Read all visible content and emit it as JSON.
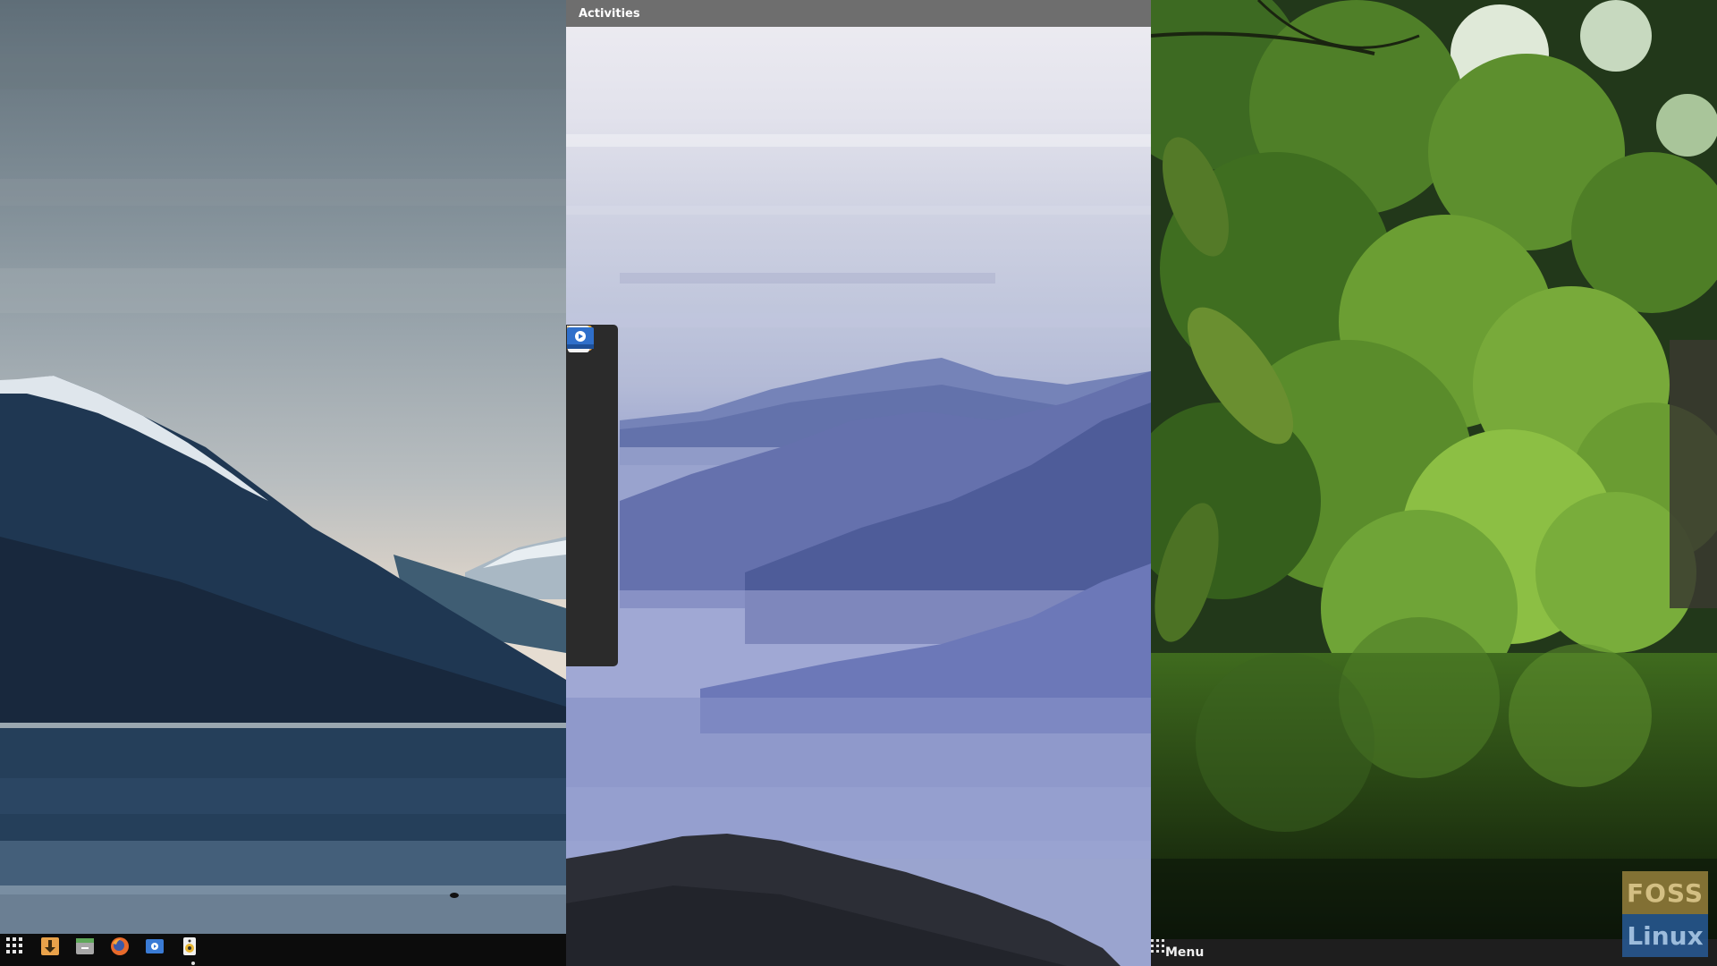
{
  "topbar": {
    "activities_label": "Activities"
  },
  "dock": {
    "items": [
      {
        "name": "app-grid",
        "icon": "app-grid-icon"
      },
      {
        "name": "downloader",
        "icon": "download-arrow-icon"
      },
      {
        "name": "archive-manager",
        "icon": "archive-icon"
      },
      {
        "name": "firefox",
        "icon": "firefox-icon"
      },
      {
        "name": "rhythmbox",
        "icon": "speaker-icon"
      },
      {
        "name": "camera",
        "icon": "webcam-icon"
      },
      {
        "name": "screenshot",
        "icon": "screen-recorder-icon"
      }
    ]
  },
  "taskbar_left": {
    "items": [
      "app-grid-icon",
      "download-arrow-icon",
      "archive-icon",
      "firefox-icon",
      "screen-recorder-icon",
      "speaker-icon"
    ]
  },
  "taskbar_right": {
    "menu_label": "Menu"
  },
  "watermark": {
    "line1": "FOSS",
    "line2": "Linux"
  },
  "colors": {
    "topbar_bg": "#6e6e6e",
    "dock_bg": "#2b2b2b",
    "taskbar_left_bg": "#0c0c0c",
    "taskbar_right_bg": "#1e1e1e",
    "accent_orange": "#f0a020"
  }
}
